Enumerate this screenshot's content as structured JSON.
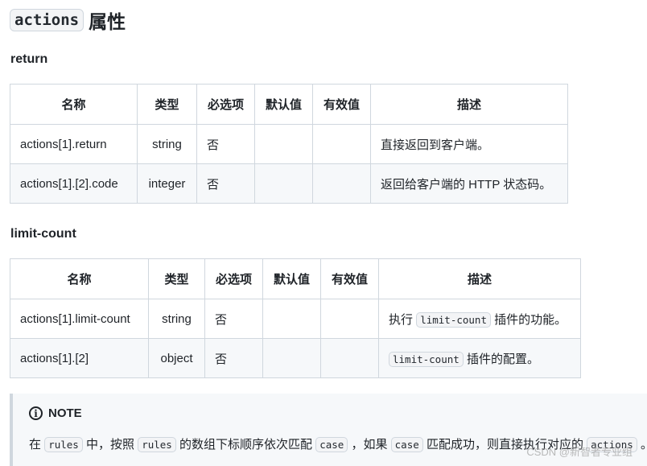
{
  "heading": {
    "code": "actions",
    "text": "属性"
  },
  "return_section": {
    "title": "return",
    "headers": [
      "名称",
      "类型",
      "必选项",
      "默认值",
      "有效值",
      "描述"
    ],
    "rows": [
      {
        "name": "actions[1].return",
        "type": "string",
        "required": "否",
        "default": "",
        "valid": "",
        "desc": "直接返回到客户端。"
      },
      {
        "name": "actions[1].[2].code",
        "type": "integer",
        "required": "否",
        "default": "",
        "valid": "",
        "desc": "返回给客户端的 HTTP 状态码。"
      }
    ]
  },
  "limit_section": {
    "title": "limit-count",
    "headers": [
      "名称",
      "类型",
      "必选项",
      "默认值",
      "有效值",
      "描述"
    ],
    "rows": [
      {
        "name": "actions[1].limit-count",
        "type": "string",
        "required": "否",
        "default": "",
        "valid": "",
        "desc_pre": "执行",
        "desc_code": "limit-count",
        "desc_post": "插件的功能。"
      },
      {
        "name": "actions[1].[2]",
        "type": "object",
        "required": "否",
        "default": "",
        "valid": "",
        "desc_pre": "",
        "desc_code": "limit-count",
        "desc_post": "插件的配置。"
      }
    ]
  },
  "note": {
    "title": "NOTE",
    "parts": [
      "在",
      "rules",
      "中，按照",
      "rules",
      "的数组下标顺序依次匹配",
      "case",
      "，如果",
      "case",
      "匹配成功，则直接执行对应的",
      "actions",
      "。"
    ]
  },
  "watermark": "CSDN @新智者专业组"
}
